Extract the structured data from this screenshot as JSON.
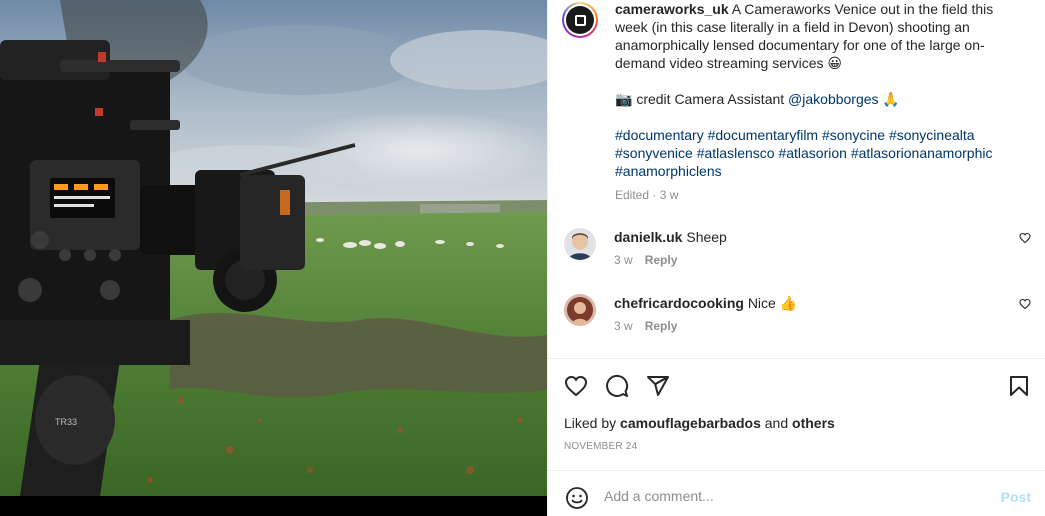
{
  "post": {
    "username": "cameraworks_uk",
    "caption_p1": " A Cameraworks Venice out in the field this week (in this case literally in a field in Devon) shooting an anamorphically lensed documentary for one of the large on-demand video streaming services 😀",
    "credit_prefix": "📷 credit Camera Assistant ",
    "credit_mention": "@jakobborges",
    "credit_suffix": " 🙏",
    "hashtags": [
      "#documentary",
      "#documentaryfilm",
      "#sonycine",
      "#sonycinealta",
      "#sonyvenice",
      "#atlaslensco",
      "#atlasorion",
      "#atlasorionanamorphic",
      "#anamorphiclens"
    ],
    "edited_label": "Edited",
    "edited_time": "3 w"
  },
  "comments": [
    {
      "username": "danielk.uk",
      "text": "Sheep",
      "time": "3 w",
      "reply": "Reply"
    },
    {
      "username": "chefricardocooking",
      "text": "Nice 👍",
      "time": "3 w",
      "reply": "Reply"
    }
  ],
  "likes": {
    "prefix": "Liked by ",
    "user": "camouflagebarbados",
    "middle": " and ",
    "others": "others"
  },
  "date": "NOVEMBER 24",
  "add_comment": {
    "placeholder": "Add a comment...",
    "post_label": "Post"
  },
  "icons": [
    "profile-avatar-icon",
    "heart-icon",
    "comment-icon",
    "share-icon",
    "bookmark-icon",
    "emoji-icon"
  ],
  "colors": {
    "link": "#00376b",
    "muted": "#8e8e8e",
    "post_disabled": "#b2dffc"
  }
}
